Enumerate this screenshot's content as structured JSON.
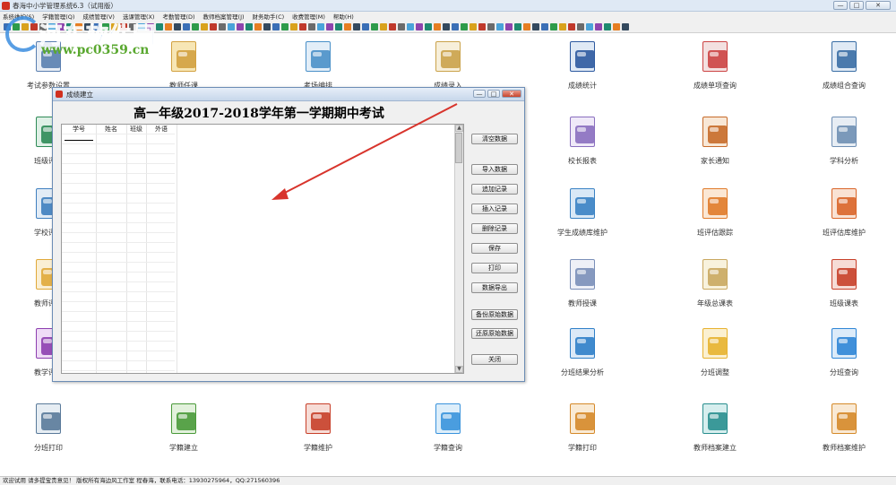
{
  "window": {
    "title": "春海中小学管理系统6.3（试用版）",
    "minimize": "—",
    "maximize": "□",
    "close": "✕"
  },
  "menu": [
    "系统维护(S)",
    "学籍管理(Q)",
    "成绩管理(V)",
    "选课管理(X)",
    "考勤管理(D)",
    "教师档案管理(J)",
    "财务助手(C)",
    "收费管理(M)",
    "帮助(H)"
  ],
  "watermark": {
    "title": "河东软件园",
    "url": "www.pc0359.cn"
  },
  "tiles": [
    {
      "label": "考试参数设置",
      "icon": "settings-doc-icon"
    },
    {
      "label": "教师任课",
      "icon": "calendar-grid-icon"
    },
    {
      "label": "考场编排",
      "icon": "house-doc-icon"
    },
    {
      "label": "成绩录入",
      "icon": "document-stack-icon"
    },
    {
      "label": "成绩统计",
      "icon": "monitor-chart-icon"
    },
    {
      "label": "成绩单项查询",
      "icon": "magnify-doc-icon"
    },
    {
      "label": "成绩组合查询",
      "icon": "magnify-list-icon"
    },
    {
      "label": "班级评估",
      "icon": "bar-chart-icon"
    },
    {
      "label": "校长报表",
      "icon": "checked-doc-icon"
    },
    {
      "label": "家长通知",
      "icon": "certificate-icon"
    },
    {
      "label": "学科分析",
      "icon": "ruler-chart-icon"
    },
    {
      "label": "学校评估",
      "icon": "chart-doc-icon"
    },
    {
      "label": "学生成绩库维护",
      "icon": "database-icon"
    },
    {
      "label": "班评估跟踪",
      "icon": "house-orange-icon"
    },
    {
      "label": "班评估库维护",
      "icon": "house-gear-icon"
    },
    {
      "label": "教师评估",
      "icon": "folder-doc-icon"
    },
    {
      "label": "教师授课",
      "icon": "anime-avatar-icon"
    },
    {
      "label": "年级总课表",
      "icon": "notepad-icon"
    },
    {
      "label": "班级课表",
      "icon": "books-icon"
    },
    {
      "label": "教学评估",
      "icon": "purple-disc-icon"
    },
    {
      "label": "分班结果分析",
      "icon": "blue-chart-icon"
    },
    {
      "label": "分班调整",
      "icon": "yellow-folder-icon"
    },
    {
      "label": "分班查询",
      "icon": "blue-folder-icon"
    },
    {
      "label": "分班打印",
      "icon": "printer-icon"
    },
    {
      "label": "学籍建立",
      "icon": "binders-icon"
    },
    {
      "label": "学籍维护",
      "icon": "red-folder-icon"
    },
    {
      "label": "学籍查询",
      "icon": "blue-folder-open-icon"
    },
    {
      "label": "学籍打印",
      "icon": "book-orange-icon"
    },
    {
      "label": "教师档案建立",
      "icon": "teal-book-icon"
    },
    {
      "label": "教师档案维护",
      "icon": "briefcase-icon"
    }
  ],
  "dialog": {
    "title": "成绩建立",
    "heading": "高一年级2017-2018学年第一学期期中考试",
    "columns": [
      "学号",
      "姓名",
      "班级",
      "外语"
    ],
    "buttons": [
      "清空数据",
      "导入数据",
      "追加记录",
      "插入记录",
      "删除记录",
      "保存",
      "打印",
      "数据导出",
      "备份原始数据",
      "还原原始数据",
      "关闭"
    ]
  },
  "status": "欢迎试用 请多提宝贵意见！ 版权所有海边风工作室 程春海，联系电话：13930275964，QQ:271560396",
  "colors": {
    "accent_red": "#d8342c",
    "watermark_blue": "#2f88e8",
    "watermark_green": "#5aa830"
  }
}
